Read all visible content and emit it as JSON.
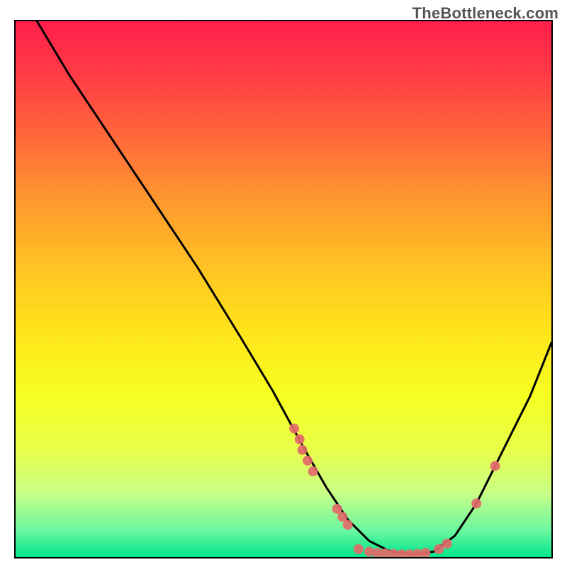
{
  "watermark": {
    "text": "TheBottleneck.com"
  },
  "chart_data": {
    "type": "line",
    "title": "",
    "xlabel": "",
    "ylabel": "",
    "xlim": [
      0,
      100
    ],
    "ylim": [
      0,
      100
    ],
    "grid": false,
    "legend": false,
    "series": [
      {
        "name": "curve",
        "color": "#000000",
        "x": [
          4,
          10,
          18,
          26,
          34,
          42,
          48,
          54,
          58,
          62,
          66,
          70,
          74,
          78,
          82,
          86,
          90,
          96,
          100
        ],
        "y": [
          100,
          90,
          78,
          66,
          54,
          41,
          31,
          20,
          13,
          7,
          3,
          1,
          0.5,
          1,
          4,
          10,
          18,
          30,
          40
        ]
      }
    ],
    "markers": [
      {
        "series": "curve",
        "x": 52.0,
        "y": 24.0
      },
      {
        "series": "curve",
        "x": 53.0,
        "y": 22.0
      },
      {
        "series": "curve",
        "x": 53.5,
        "y": 20.0
      },
      {
        "series": "curve",
        "x": 54.5,
        "y": 18.0
      },
      {
        "series": "curve",
        "x": 55.5,
        "y": 16.0
      },
      {
        "series": "curve",
        "x": 60.0,
        "y": 9.0
      },
      {
        "series": "curve",
        "x": 61.0,
        "y": 7.5
      },
      {
        "series": "curve",
        "x": 62.0,
        "y": 6.0
      },
      {
        "series": "curve",
        "x": 64.0,
        "y": 1.5
      },
      {
        "series": "curve",
        "x": 66.0,
        "y": 1.0
      },
      {
        "series": "curve",
        "x": 67.5,
        "y": 0.8
      },
      {
        "series": "curve",
        "x": 69.0,
        "y": 0.7
      },
      {
        "series": "curve",
        "x": 70.5,
        "y": 0.6
      },
      {
        "series": "curve",
        "x": 72.0,
        "y": 0.5
      },
      {
        "series": "curve",
        "x": 73.5,
        "y": 0.5
      },
      {
        "series": "curve",
        "x": 75.0,
        "y": 0.6
      },
      {
        "series": "curve",
        "x": 76.5,
        "y": 0.8
      },
      {
        "series": "curve",
        "x": 79.0,
        "y": 1.5
      },
      {
        "series": "curve",
        "x": 80.5,
        "y": 2.5
      },
      {
        "series": "curve",
        "x": 86.0,
        "y": 10.0
      },
      {
        "series": "curve",
        "x": 89.5,
        "y": 17.0
      }
    ],
    "marker_style": {
      "color": "#e26a6a",
      "radius": 7
    },
    "background_gradient": {
      "direction": "vertical",
      "stops": [
        {
          "pos": 0.0,
          "color": "#ff1f4b"
        },
        {
          "pos": 0.22,
          "color": "#ff6a3a"
        },
        {
          "pos": 0.46,
          "color": "#ffc323"
        },
        {
          "pos": 0.7,
          "color": "#f6ff22"
        },
        {
          "pos": 0.95,
          "color": "#6bf7a0"
        },
        {
          "pos": 1.0,
          "color": "#00e58a"
        }
      ]
    }
  }
}
